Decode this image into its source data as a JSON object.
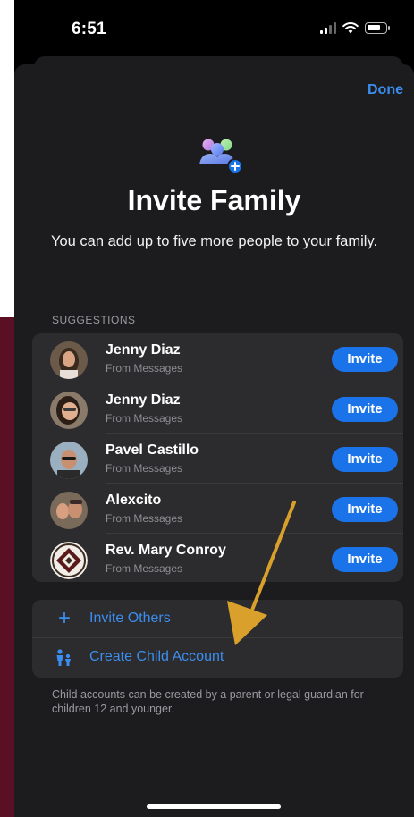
{
  "status_bar": {
    "time": "6:51"
  },
  "sheet": {
    "done_label": "Done",
    "title": "Invite Family",
    "subtitle": "You can add up to five more people to your family."
  },
  "suggestions": {
    "header": "SUGGESTIONS",
    "invite_label": "Invite",
    "people": [
      {
        "name": "Jenny Diaz",
        "source": "From Messages"
      },
      {
        "name": "Jenny Diaz",
        "source": "From Messages"
      },
      {
        "name": "Pavel Castillo",
        "source": "From Messages"
      },
      {
        "name": "Alexcito",
        "source": "From Messages"
      },
      {
        "name": "Rev. Mary Conroy",
        "source": "From Messages"
      }
    ]
  },
  "actions": {
    "invite_others": {
      "label": "Invite Others",
      "icon": "plus-icon"
    },
    "create_child": {
      "label": "Create Child Account",
      "icon": "child-account-icon"
    }
  },
  "footer_note": "Child accounts can be created by a parent or legal guardian for children 12 and younger.",
  "colors": {
    "accent": "#3b8ef0",
    "invite_button": "#1a73e8",
    "annotation_arrow": "#d9a12b"
  }
}
